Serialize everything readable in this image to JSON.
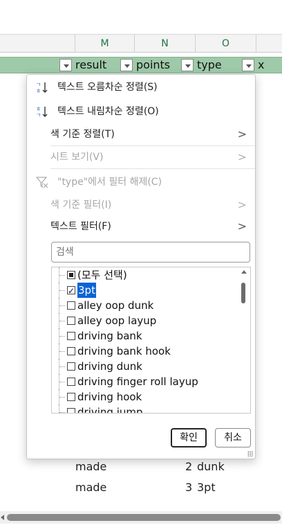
{
  "columns": [
    "M",
    "N",
    "O"
  ],
  "header_cells": {
    "result": "result",
    "points": "points",
    "type": "type",
    "x": "x"
  },
  "rows": [
    {
      "result": "made",
      "points": "2",
      "type": "dunk"
    },
    {
      "result": "made",
      "points": "3",
      "type": "3pt"
    }
  ],
  "menu": {
    "sort_asc": "텍스트 오름차순 정렬(S)",
    "sort_desc": "텍스트 내림차순 정렬(O)",
    "sort_by_color": "색 기준 정렬(T)",
    "sheet_view": "시트 보기(V)",
    "clear_filter": "\"type\"에서 필터 해제(C)",
    "filter_by_color": "색 기준 필터(I)",
    "text_filter": "텍스트 필터(F)",
    "chevron": ">"
  },
  "search": {
    "placeholder": "검색"
  },
  "filter_list": [
    {
      "label": "(모두 선택)",
      "state": "partial"
    },
    {
      "label": "3pt",
      "state": "checked",
      "selected": true
    },
    {
      "label": "alley oop dunk",
      "state": "unchecked"
    },
    {
      "label": "alley oop layup",
      "state": "unchecked"
    },
    {
      "label": "driving bank",
      "state": "unchecked"
    },
    {
      "label": "driving bank hook",
      "state": "unchecked"
    },
    {
      "label": "driving dunk",
      "state": "unchecked"
    },
    {
      "label": "driving finger roll layup",
      "state": "unchecked"
    },
    {
      "label": "driving hook",
      "state": "unchecked"
    },
    {
      "label": "driving jump",
      "state": "unchecked"
    }
  ],
  "buttons": {
    "ok": "확인",
    "cancel": "취소"
  },
  "icons": {
    "sort_asc": "sort-ascending-icon",
    "sort_desc": "sort-descending-icon",
    "clear_filter": "clear-filter-icon"
  },
  "colors": {
    "header_green": "#9fcaa9",
    "column_letter": "#217346",
    "selection": "#0a64d6"
  }
}
